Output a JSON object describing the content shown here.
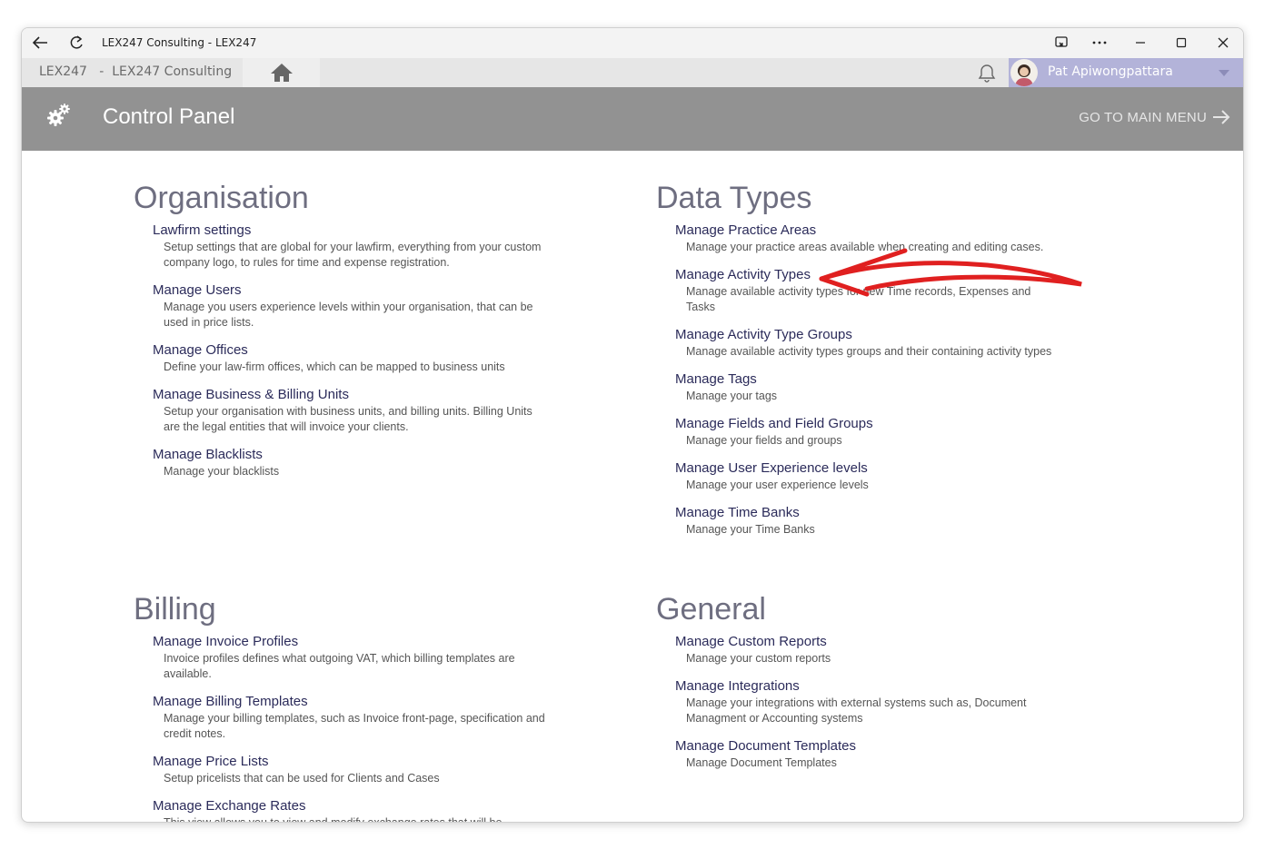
{
  "titlebar": {
    "title": "LEX247 Consulting - LEX247"
  },
  "appbar": {
    "breadcrumb": "LEX247   -  LEX247 Consulting",
    "user_name": "Pat Apiwongpattara"
  },
  "header": {
    "title": "Control Panel",
    "main_menu_label": "GO TO MAIN MENU"
  },
  "sections": {
    "organisation": {
      "title": "Organisation",
      "items": [
        {
          "title": "Lawfirm settings",
          "desc": "Setup settings that are global for your lawfirm, everything from your custom company logo, to rules for time and expense registration."
        },
        {
          "title": "Manage Users",
          "desc": "Manage you users experience levels within your organisation, that can be used in price lists."
        },
        {
          "title": "Manage Offices",
          "desc": "Define your law-firm offices, which can be mapped to business units"
        },
        {
          "title": "Manage Business & Billing Units",
          "desc": "Setup your organisation with business units, and billing units. Billing Units are the legal entities that will invoice your clients."
        },
        {
          "title": "Manage Blacklists",
          "desc": "Manage your blacklists"
        }
      ]
    },
    "data_types": {
      "title": "Data Types",
      "items": [
        {
          "title": "Manage Practice Areas",
          "desc": "Manage your practice areas available when creating and editing cases."
        },
        {
          "title": "Manage Activity Types",
          "desc": "Manage available activity types for new Time records, Expenses and Tasks"
        },
        {
          "title": "Manage Activity Type Groups",
          "desc": "Manage available activity types groups and their containing activity types"
        },
        {
          "title": "Manage Tags",
          "desc": "Manage your tags"
        },
        {
          "title": "Manage Fields and Field Groups",
          "desc": "Manage your fields and groups"
        },
        {
          "title": "Manage User Experience levels",
          "desc": "Manage your user experience levels"
        },
        {
          "title": "Manage Time Banks",
          "desc": "Manage your Time Banks"
        }
      ]
    },
    "billing": {
      "title": "Billing",
      "items": [
        {
          "title": "Manage Invoice Profiles",
          "desc": "Invoice profiles defines what outgoing VAT, which billing templates are available."
        },
        {
          "title": "Manage Billing Templates",
          "desc": "Manage your billing templates, such as Invoice front-page, specification and credit notes."
        },
        {
          "title": "Manage Price Lists",
          "desc": "Setup pricelists that can be used for Clients and Cases"
        },
        {
          "title": "Manage Exchange Rates",
          "desc": "This view allows you to view and modify exchange rates that will be"
        }
      ]
    },
    "general": {
      "title": "General",
      "items": [
        {
          "title": "Manage Custom Reports",
          "desc": "Manage your custom reports"
        },
        {
          "title": "Manage Integrations",
          "desc": "Manage your integrations with external systems such as, Document Managment or Accounting systems"
        },
        {
          "title": "Manage Document Templates",
          "desc": "Manage Document Templates"
        }
      ]
    }
  },
  "icons": {
    "back": "arrow-left-icon",
    "refresh": "refresh-icon",
    "home": "home-icon",
    "bell": "bell-icon",
    "gear": "gears-icon",
    "arrow": "arrow-right-icon"
  },
  "colors": {
    "header_bg": "#929292",
    "user_box": "#b3b3d9",
    "link": "#2b2b5a",
    "annotation": "#e02020"
  }
}
